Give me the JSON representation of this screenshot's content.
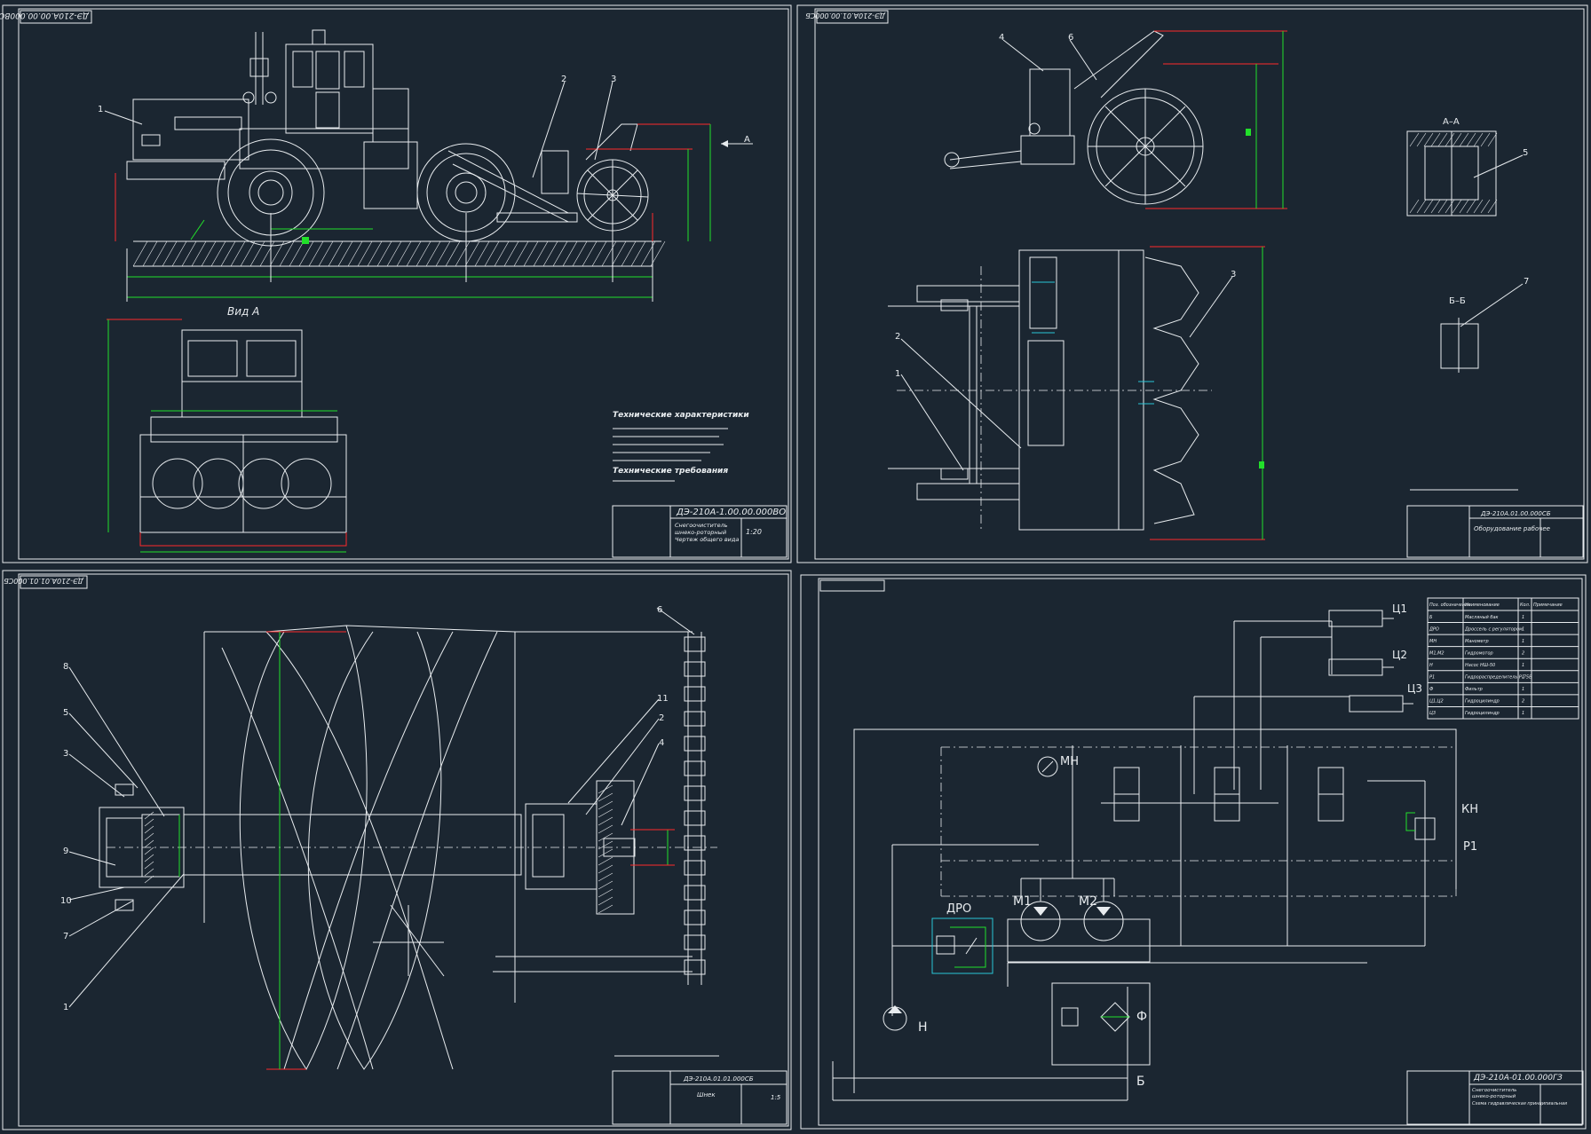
{
  "colors": {
    "background": "#1b2631",
    "lines": "#e8ecef",
    "dimension": "#22e02a",
    "outline_red": "#ff2a2a",
    "cyan": "#29c6d8"
  },
  "sheet1": {
    "corner_code": "ДЭ-210А.00.00.000ВО",
    "view_label": "Вид А",
    "arrow_label": "А",
    "callouts": [
      "1",
      "2",
      "3"
    ],
    "tech_title": "Технические характеристики",
    "tech_title2": "Технические требования",
    "stamp_code": "ДЭ-210А-1.00.00.000ВО",
    "stamp_name_1": "Снегоочиститель",
    "stamp_name_2": "шнеко-роторный",
    "stamp_name_3": "Чертеж общего вида",
    "stamp_scale": "1:20"
  },
  "sheet2": {
    "corner_code": "ДЭ-210А.01.00.000СБ",
    "callouts": [
      "4",
      "6",
      "2",
      "1",
      "3",
      "5",
      "7"
    ],
    "section_aa": "А–А",
    "section_bb": "Б–Б",
    "stamp_code": "ДЭ-210А.01.00.000СБ",
    "stamp_name": "Оборудование рабочее"
  },
  "sheet3": {
    "corner_code": "ДЭ-210А.01.01.000СБ",
    "callouts": [
      "8",
      "5",
      "3",
      "9",
      "10",
      "7",
      "1",
      "11",
      "2",
      "4",
      "6"
    ],
    "stamp_code": "ДЭ-210А.01.01.000СБ",
    "stamp_name": "Шнек",
    "stamp_scale": "1:5"
  },
  "sheet4": {
    "labels": {
      "c1": "Ц1",
      "c2": "Ц2",
      "c3": "Ц3",
      "mn": "МН",
      "kn": "КН",
      "r1": "Р1",
      "dro": "ДРО",
      "m1": "М1",
      "m2": "М2",
      "h": "Н",
      "f": "Ф",
      "b": "Б"
    },
    "table_headers": [
      "Поз. обозначение",
      "Наименование",
      "Кол.",
      "Примечание"
    ],
    "table_rows": [
      [
        "Б",
        "Масляный бак",
        "1",
        ""
      ],
      [
        "ДРО",
        "Дроссель с регулятором",
        "1",
        ""
      ],
      [
        "МН",
        "Манометр",
        "1",
        ""
      ],
      [
        "М1,М2",
        "Гидромотор",
        "2",
        ""
      ],
      [
        "Н",
        "Насос НШ-50",
        "1",
        ""
      ],
      [
        "Р1",
        "Гидрораспределитель Р-75В",
        "1",
        ""
      ],
      [
        "Ф",
        "Фильтр",
        "1",
        ""
      ],
      [
        "Ц1,Ц2",
        "Гидроцилиндр",
        "2",
        ""
      ],
      [
        "Ц3",
        "Гидроцилиндр",
        "1",
        ""
      ]
    ],
    "stamp_code": "ДЭ-210А-01.00.000ГЗ",
    "stamp_name_1": "Снегоочиститель",
    "stamp_name_2": "шнеко-роторный",
    "stamp_name_3": "Схема гидравлическая принципиальная"
  }
}
